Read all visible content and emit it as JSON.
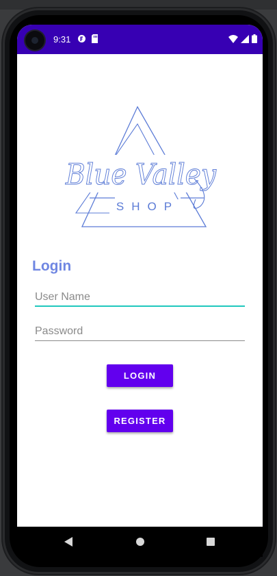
{
  "status_bar": {
    "time": "9:31",
    "icons": [
      "camera-punch-hole",
      "app-notification-icon",
      "sd-card-icon",
      "wifi-icon",
      "cell-signal-icon",
      "battery-icon"
    ]
  },
  "logo": {
    "brand_script": "Blue Valley",
    "brand_sub": "SHOP",
    "color": "#5b7bd6"
  },
  "login": {
    "title": "Login",
    "username_placeholder": "User Name",
    "password_placeholder": "Password",
    "login_label": "LOGIN",
    "register_label": "REGISTER"
  },
  "navigation": {
    "buttons": [
      "back-icon",
      "home-icon",
      "recents-icon"
    ]
  },
  "colors": {
    "status_bar": "#3700b3",
    "button": "#6200ee",
    "title": "#6f86e2",
    "active_underline": "#1fc7bd"
  }
}
